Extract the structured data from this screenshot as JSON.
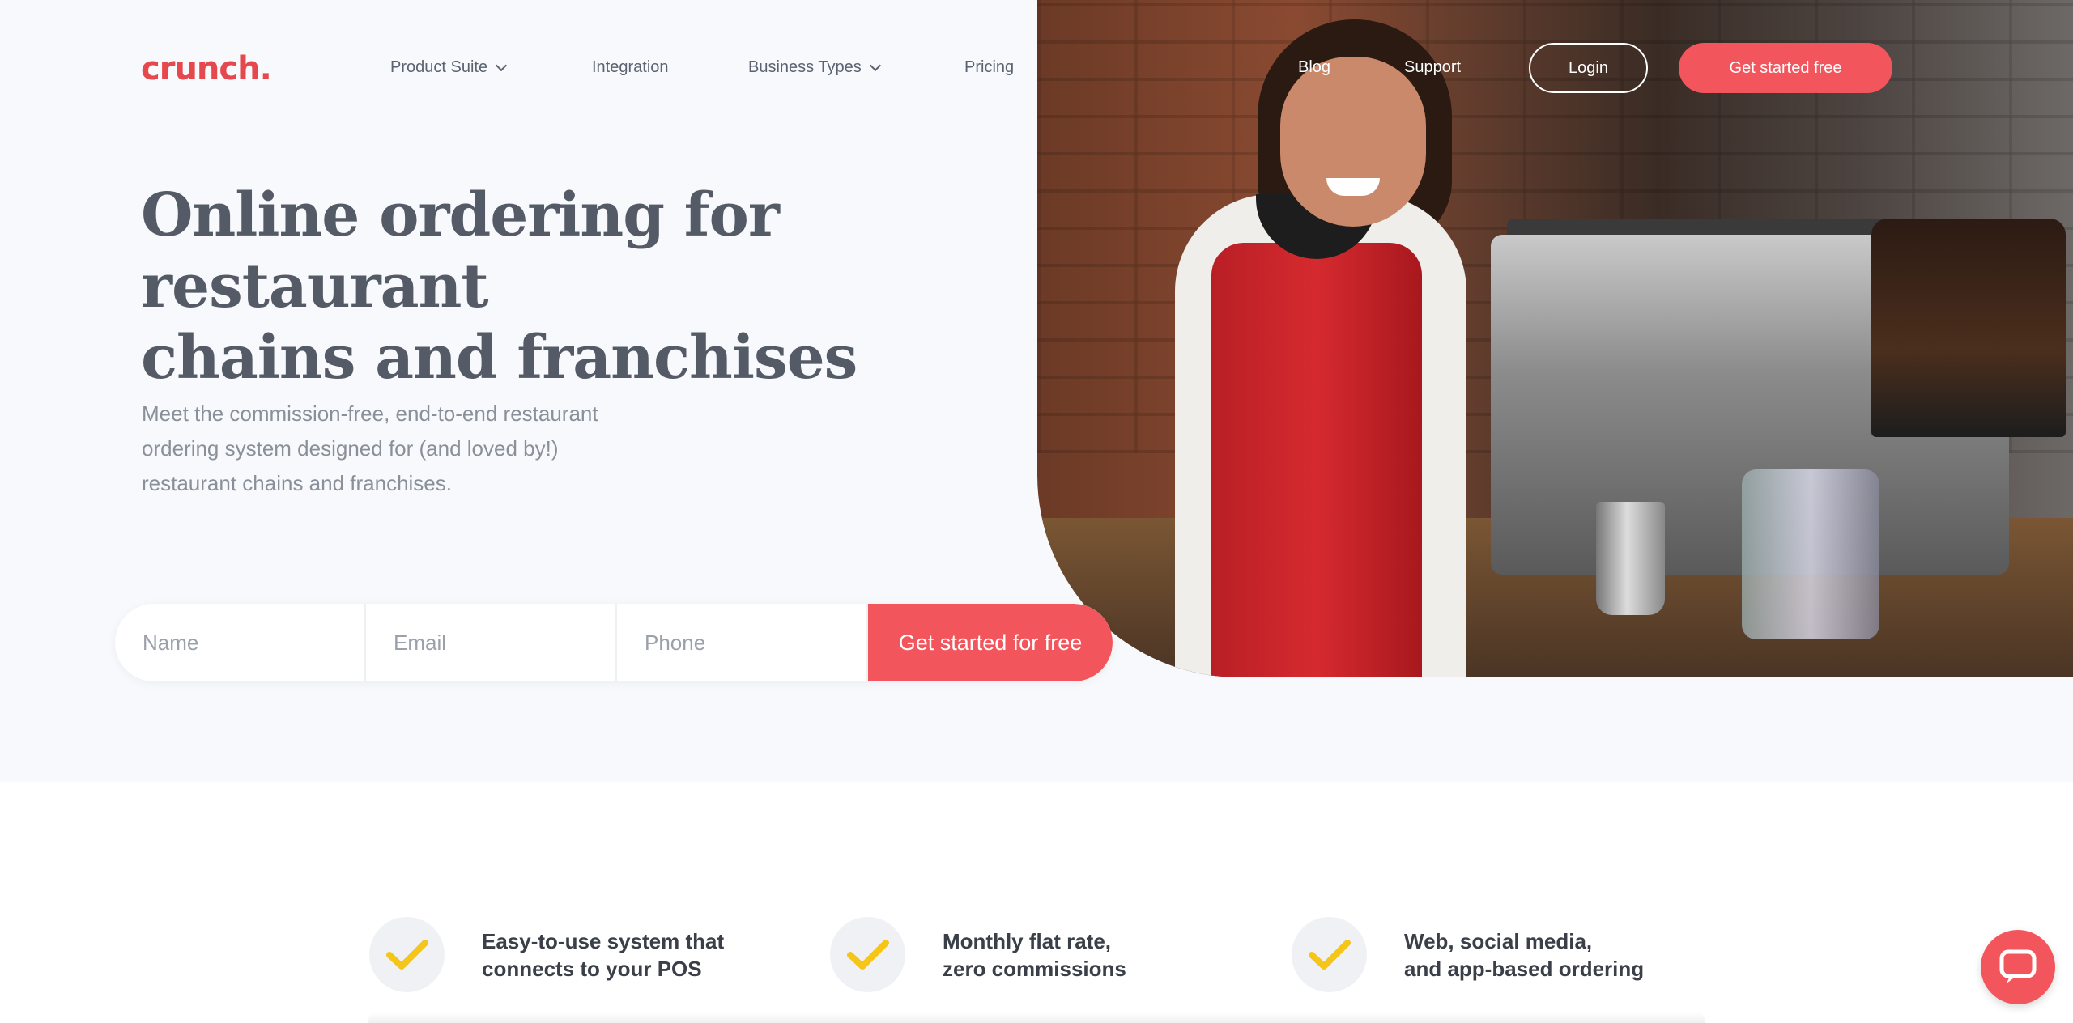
{
  "brand": {
    "logo_text": "crunch.",
    "accent_color": "#f2555b",
    "logo_color": "#e5484d"
  },
  "nav": {
    "items": [
      {
        "label": "Product Suite",
        "has_dropdown": true
      },
      {
        "label": "Integration",
        "has_dropdown": false
      },
      {
        "label": "Business Types",
        "has_dropdown": true
      },
      {
        "label": "Pricing",
        "has_dropdown": false
      },
      {
        "label": "Blog",
        "has_dropdown": false
      },
      {
        "label": "Support",
        "has_dropdown": false
      }
    ],
    "login_label": "Login",
    "cta_label": "Get started free"
  },
  "hero": {
    "headline_line1": "Online ordering for restaurant",
    "headline_line2": "chains and franchises",
    "sub_line1": "Meet the commission-free, end-to-end restaurant",
    "sub_line2": "ordering system designed for (and loved by!)",
    "sub_line3": "restaurant chains and franchises.",
    "form": {
      "name_placeholder": "Name",
      "email_placeholder": "Email",
      "phone_placeholder": "Phone",
      "submit_label": "Get started for free"
    }
  },
  "features": [
    {
      "line1": "Easy-to-use system that",
      "line2": "connects to your POS",
      "icon": "check-icon"
    },
    {
      "line1": "Monthly flat rate,",
      "line2": "zero commissions",
      "icon": "check-icon"
    },
    {
      "line1": "Web, social media,",
      "line2": "and app-based ordering",
      "icon": "check-icon"
    }
  ],
  "check_color": "#f5c518",
  "chat_icon": "chat-icon"
}
